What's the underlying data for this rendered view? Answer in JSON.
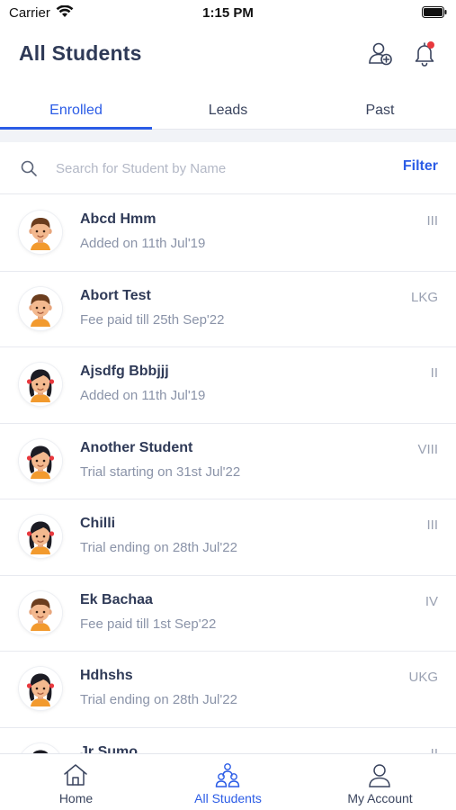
{
  "status_bar": {
    "carrier": "Carrier",
    "time": "1:15 PM"
  },
  "header": {
    "title": "All Students"
  },
  "tabs": [
    {
      "label": "Enrolled",
      "active": true
    },
    {
      "label": "Leads",
      "active": false
    },
    {
      "label": "Past",
      "active": false
    }
  ],
  "search": {
    "placeholder": "Search for Student by Name",
    "value": "",
    "filter_label": "Filter"
  },
  "students": [
    {
      "name": "Abcd Hmm",
      "subtitle": "Added on 11th Jul'19",
      "class": "III",
      "avatar": "boy"
    },
    {
      "name": "Abort Test",
      "subtitle": "Fee paid till 25th Sep'22",
      "class": "LKG",
      "avatar": "boy"
    },
    {
      "name": "Ajsdfg Bbbjjj",
      "subtitle": "Added on 11th Jul'19",
      "class": "II",
      "avatar": "girl"
    },
    {
      "name": "Another Student",
      "subtitle": "Trial starting on 31st Jul'22",
      "class": "VIII",
      "avatar": "girl"
    },
    {
      "name": "Chilli",
      "subtitle": "Trial ending on 28th Jul'22",
      "class": "III",
      "avatar": "girl"
    },
    {
      "name": "Ek Bachaa",
      "subtitle": "Fee paid till 1st Sep'22",
      "class": "IV",
      "avatar": "boy"
    },
    {
      "name": "Hdhshs",
      "subtitle": "Trial ending on 28th Jul'22",
      "class": "UKG",
      "avatar": "girl"
    },
    {
      "name": "Jr Sumo",
      "subtitle": "",
      "class": "II",
      "avatar": "girl"
    }
  ],
  "bottom_nav": [
    {
      "label": "Home",
      "icon": "home-icon",
      "active": false
    },
    {
      "label": "All Students",
      "icon": "students-icon",
      "active": true
    },
    {
      "label": "My Account",
      "icon": "account-icon",
      "active": false
    }
  ],
  "colors": {
    "accent": "#2b5ce6",
    "text": "#2f3a57",
    "muted": "#8a93a8",
    "notification": "#e8383d"
  }
}
